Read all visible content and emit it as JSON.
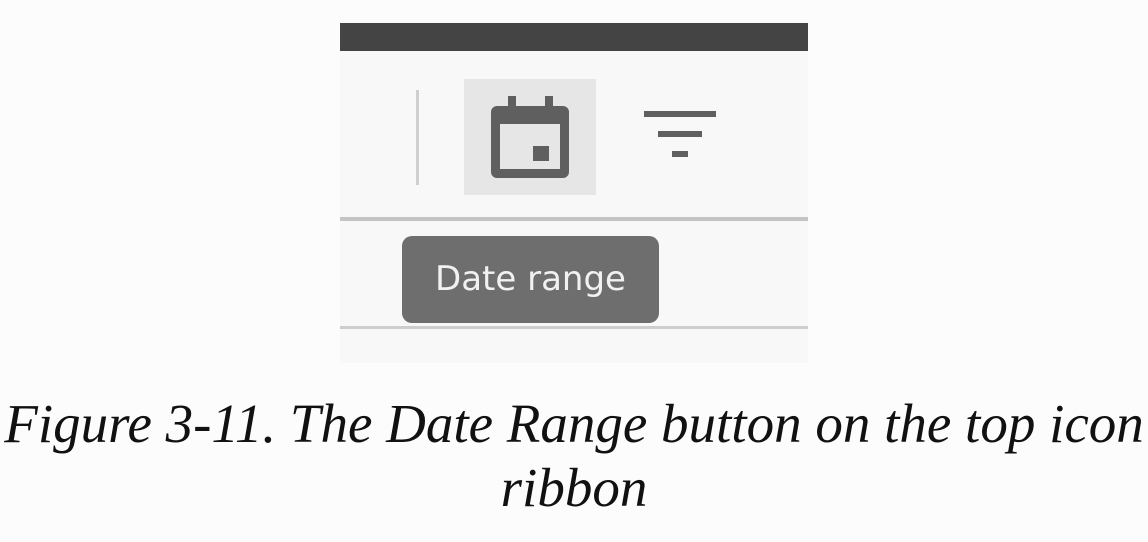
{
  "toolbar": {
    "date_range_button": {
      "icon": "calendar-icon"
    },
    "filter_button": {
      "icon": "filter-icon"
    }
  },
  "tooltip": {
    "text": "Date range"
  },
  "caption": {
    "label": "Figure 3-11",
    "text": "The Date Range button on the top icon ribbon"
  },
  "colors": {
    "top_bar": "#444444",
    "icon": "#5f5f5f",
    "button_highlight": "#e6e6e6",
    "tooltip_bg": "#6e6e6e",
    "tooltip_text": "#f1f1f1",
    "panel_bg": "#f8f8f8"
  }
}
